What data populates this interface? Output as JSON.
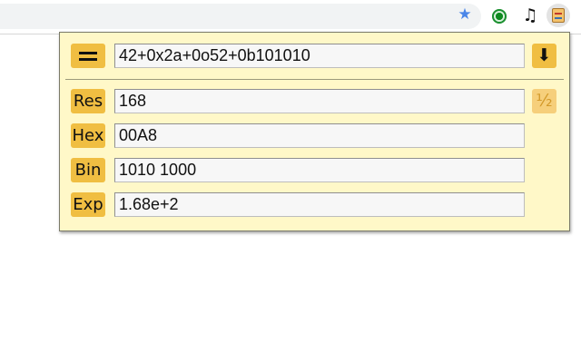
{
  "browser": {
    "icons": [
      "star-icon",
      "green-circle-extension-icon",
      "music-note-extension-icon",
      "calculator-extension-icon"
    ],
    "star_glyph": "★",
    "music_glyph": "♫"
  },
  "calculator": {
    "expression": "42+0x2a+0o52+0b101010",
    "down_glyph": "⬇",
    "half_glyph": "½",
    "results": [
      {
        "label": "Res",
        "value": "168"
      },
      {
        "label": "Hex",
        "value": "00A8"
      },
      {
        "label": "Bin",
        "value": "1010 1000"
      },
      {
        "label": "Exp",
        "value": "1.68e+2"
      }
    ]
  },
  "colors": {
    "button": "#f0be42",
    "popup_background": "#fff8c8",
    "star": "#4a86e8",
    "field": "#f7f7f7"
  }
}
